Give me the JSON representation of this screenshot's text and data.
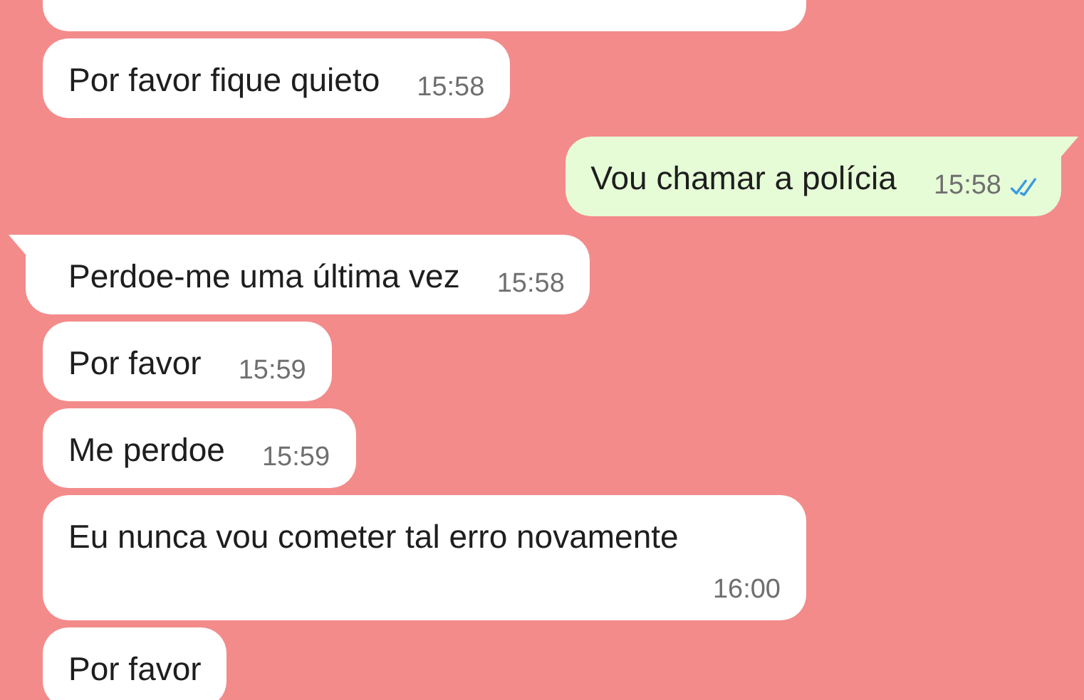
{
  "messages": [
    {
      "kind": "incoming",
      "tail": false
    },
    {
      "kind": "incoming",
      "tail": false,
      "text": "Por favor fique quieto",
      "time": "15:58"
    },
    {
      "kind": "outgoing",
      "tail": true,
      "text": "Vou chamar a polícia",
      "time": "15:58",
      "read": true
    },
    {
      "kind": "incoming",
      "tail": true,
      "text": "Perdoe-me uma última vez",
      "time": "15:58"
    },
    {
      "kind": "incoming",
      "tail": false,
      "text": "Por favor",
      "time": "15:59"
    },
    {
      "kind": "incoming",
      "tail": false,
      "text": "Me perdoe",
      "time": "15:59"
    },
    {
      "kind": "incoming",
      "tail": false,
      "text": "Eu nunca vou cometer tal erro novamente",
      "time": "16:00"
    },
    {
      "kind": "incoming",
      "tail": false,
      "text": "Por favor"
    }
  ]
}
